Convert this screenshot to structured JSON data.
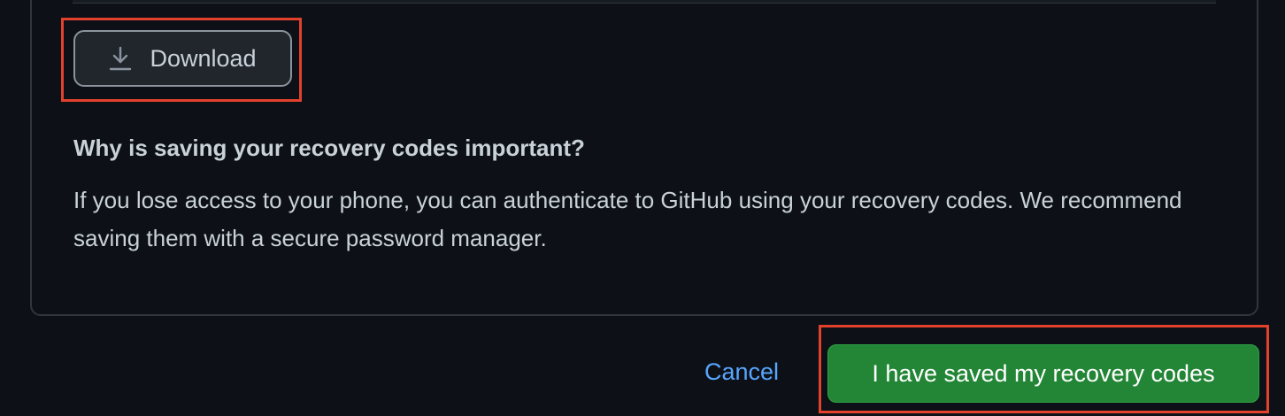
{
  "download": {
    "label": "Download",
    "icon": "download-icon"
  },
  "info": {
    "heading": "Why is saving your recovery codes important?",
    "body": "If you lose access to your phone, you can authenticate to GitHub using your recovery codes. We recommend saving them with a secure password manager."
  },
  "actions": {
    "cancel_label": "Cancel",
    "confirm_label": "I have saved my recovery codes"
  },
  "colors": {
    "background": "#0d1117",
    "accent_link": "#58a6ff",
    "primary_button": "#238636",
    "highlight": "#e2412c"
  }
}
